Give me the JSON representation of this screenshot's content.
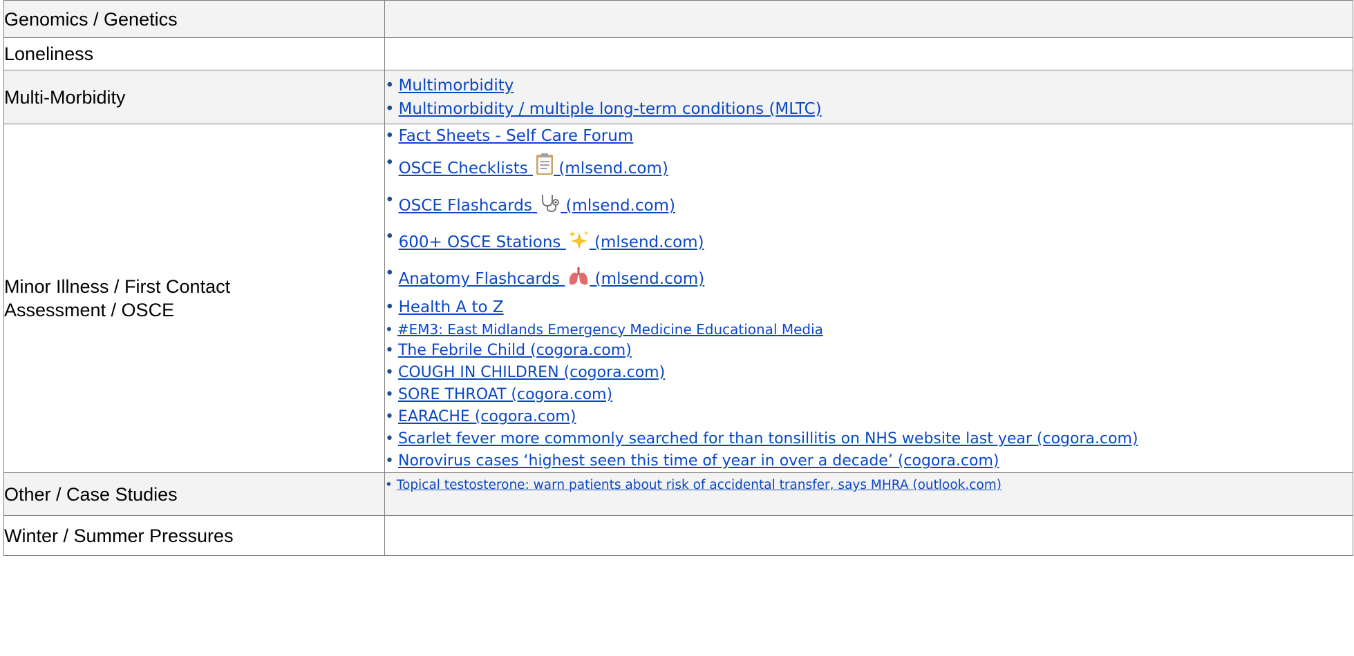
{
  "rows": [
    {
      "label": "Genomics / Genetics",
      "links": []
    },
    {
      "label": "Loneliness",
      "links": []
    },
    {
      "label": "Multi-Morbidity",
      "links": [
        {
          "text": "Multimorbidity"
        },
        {
          "text": "Multimorbidity / multiple long-term conditions (MLTC)"
        }
      ]
    },
    {
      "label_lines": [
        "Minor Illness / First Contact",
        "Assessment / OSCE"
      ],
      "links": [
        {
          "text": "Fact Sheets - Self Care Forum"
        },
        {
          "text": "OSCE Checklists",
          "suffix": " (mlsend.com)",
          "icon": "clipboard-icon"
        },
        {
          "text": "OSCE Flashcards",
          "suffix": " (mlsend.com)",
          "icon": "stethoscope-icon"
        },
        {
          "text": "600+ OSCE Stations",
          "suffix": " (mlsend.com)",
          "icon": "sparkles-icon"
        },
        {
          "text": "Anatomy Flashcards",
          "suffix": " (mlsend.com)",
          "icon": "lungs-icon"
        },
        {
          "text": "Health A to Z"
        },
        {
          "text": "#EM3: East Midlands Emergency Medicine Educational Media"
        },
        {
          "text": "The Febrile Child (cogora.com)"
        },
        {
          "text": "COUGH IN CHILDREN (cogora.com)"
        },
        {
          "text": "SORE THROAT (cogora.com)"
        },
        {
          "text": "EARACHE (cogora.com)"
        },
        {
          "text": "Scarlet fever more commonly searched for than tonsillitis on NHS website last year (cogora.com)"
        },
        {
          "text": "Norovirus cases ‘highest seen this time of year in over a decade’ (cogora.com)"
        }
      ]
    },
    {
      "label": "Other / Case Studies",
      "links": [
        {
          "text": "Topical testosterone: warn patients about risk of accidental transfer, says MHRA (outlook.com)"
        }
      ]
    },
    {
      "label": "Winter / Summer Pressures",
      "links": []
    }
  ],
  "colors": {
    "link": "#0b47c4",
    "border": "#7f7f7f",
    "shade": "#f3f3f3"
  }
}
